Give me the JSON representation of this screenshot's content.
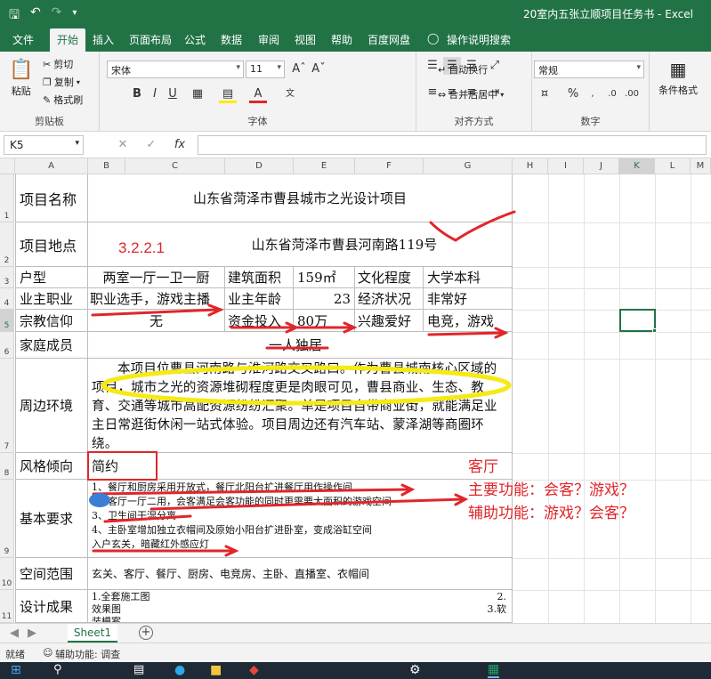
{
  "window": {
    "title": "20室内五张立顺项目任务书 - Excel"
  },
  "quick_access": {
    "save_icon": "save-icon",
    "undo_icon": "undo-icon",
    "redo_icon": "redo-icon"
  },
  "ribbon_tabs": [
    "文件",
    "开始",
    "插入",
    "页面布局",
    "公式",
    "数据",
    "审阅",
    "视图",
    "帮助",
    "百度网盘",
    "操作说明搜索"
  ],
  "ribbon": {
    "clipboard": {
      "paste": "粘贴",
      "cut": "剪切",
      "copy": "复制",
      "format_painter": "格式刷",
      "label": "剪贴板"
    },
    "font": {
      "name": "宋体",
      "size": "11",
      "label": "字体",
      "bold": "B",
      "italic": "I",
      "underline": "U",
      "font_color": "A"
    },
    "alignment": {
      "wrap": "自动换行",
      "merge": "合并后居中",
      "label": "对齐方式"
    },
    "number": {
      "format": "常规",
      "label": "数字",
      "percent": "%"
    },
    "styles": {
      "conditional": "条件格式"
    }
  },
  "formula_bar": {
    "name_box": "K5",
    "fx": "fx",
    "content": ""
  },
  "columns": [
    "A",
    "B",
    "C",
    "D",
    "E",
    "F",
    "G",
    "H",
    "I",
    "J",
    "K",
    "L",
    "M"
  ],
  "rows": [
    "1",
    "2",
    "3",
    "4",
    "5",
    "6",
    "7",
    "8",
    "9",
    "10",
    "11"
  ],
  "cells": {
    "r1_label": "项目名称",
    "r1_value": "山东省菏泽市曹县城市之光设计项目",
    "r2_label": "项目地点",
    "r2_value": "山东省菏泽市曹县河南路119号",
    "r3_a": "户型",
    "r3_bc": "两室一厅一卫一厨",
    "r3_d": "建筑面积",
    "r3_e": "159㎡",
    "r3_f": "文化程度",
    "r3_g": "大学本科",
    "r4_a": "业主职业",
    "r4_bc": "职业选手，游戏主播",
    "r4_d": "业主年龄",
    "r4_e": "23",
    "r4_f": "经济状况",
    "r4_g": "非常好",
    "r5_a": "宗教信仰",
    "r5_bc": "无",
    "r5_d": "资金投入",
    "r5_e": "80万",
    "r5_f": "兴趣爱好",
    "r5_g": "电竞，游戏",
    "r6_a": "家庭成员",
    "r6_value": "一人独居",
    "r7_a": "周边环境",
    "r7_value": "本项目位曹县河南路与淮河路交叉路口。作为曹县城南核心区域的项目，城市之光的资源堆砌程度更是肉眼可见，曹县商业、生态、教育、交通等城市高配资源纷纷汇聚。单是项目自带商业街，就能满足业主日常逛街休闲一站式体验。项目周边还有汽车站、蒙泽湖等商圈环绕。",
    "r8_a": "风格倾向",
    "r8_value": "简约",
    "r9_a": "基本要求",
    "r9_lines": [
      "1、餐厅和厨房采用开放式，餐厅北阳台扩进餐厅用作操作间",
      "2、客厅一厅二用，会客满足会客功能的同时更需要大面积的游戏空间",
      "3、卫生间干湿分离",
      "4、主卧室增加独立衣帽间及原始小阳台扩进卧室，变成浴缸空间",
      "入户玄关，暗藏红外感应灯"
    ],
    "r10_a": "空间范围",
    "r10_value": "玄关、客厅、餐厅、厨房、电竞房、主卧、直播室、衣帽间",
    "r11_a": "设计成果",
    "r11_lines": [
      "1.全套施工图",
      "效果图",
      "装模案"
    ],
    "r11_right": [
      "2.",
      "3.软"
    ]
  },
  "annotations": {
    "section_number": "3.2.2.1",
    "living_room": "客厅",
    "main_function": "主要功能：会客？游戏？",
    "aux_function": "辅助功能：游戏？会客？",
    "red_color": "#e0262b",
    "yellow_color": "#f5ea14",
    "blue_color": "#3a7fd5"
  },
  "sheet_tabs": {
    "active": "Sheet1",
    "add": "+"
  },
  "status": {
    "ready": "就绪",
    "accessibility": "辅助功能: 调查"
  }
}
